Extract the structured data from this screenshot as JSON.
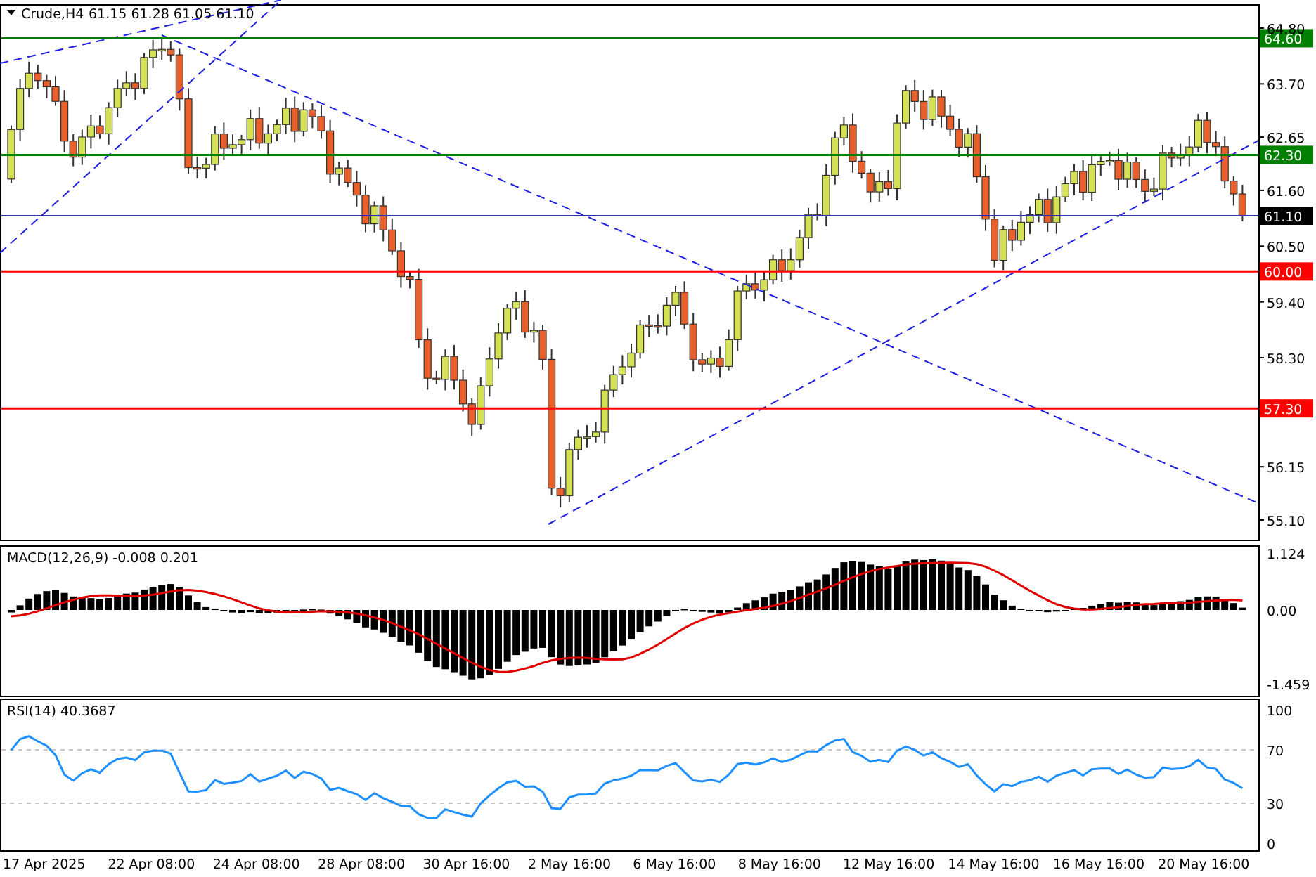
{
  "header": {
    "symbol": "Crude,H4",
    "ohlc": "61.15 61.28 61.05 61.10"
  },
  "price_axis": {
    "labels": [
      "64.80",
      "63.70",
      "62.65",
      "61.60",
      "60.50",
      "59.40",
      "58.30",
      "56.15",
      "55.10"
    ]
  },
  "levels": [
    {
      "label": "64.60",
      "color": "#008000"
    },
    {
      "label": "62.30",
      "color": "#008000"
    },
    {
      "label": "60.00",
      "color": "#ff0000"
    },
    {
      "label": "57.30",
      "color": "#ff0000"
    }
  ],
  "current_price": {
    "label": "61.10"
  },
  "macd": {
    "title": "MACD(12,26,9) -0.008 0.201",
    "axis_labels": [
      "1.124",
      "0.00",
      "-1.459"
    ]
  },
  "rsi": {
    "title": "RSI(14) 40.3687",
    "axis_labels": [
      "100",
      "70",
      "30",
      "0"
    ]
  },
  "time_axis": {
    "labels": [
      "17 Apr 2025",
      "22 Apr 08:00",
      "24 Apr 08:00",
      "28 Apr 08:00",
      "30 Apr 16:00",
      "2 May 16:00",
      "6 May 16:00",
      "8 May 16:00",
      "12 May 16:00",
      "14 May 16:00",
      "16 May 16:00",
      "20 May 16:00"
    ]
  }
}
